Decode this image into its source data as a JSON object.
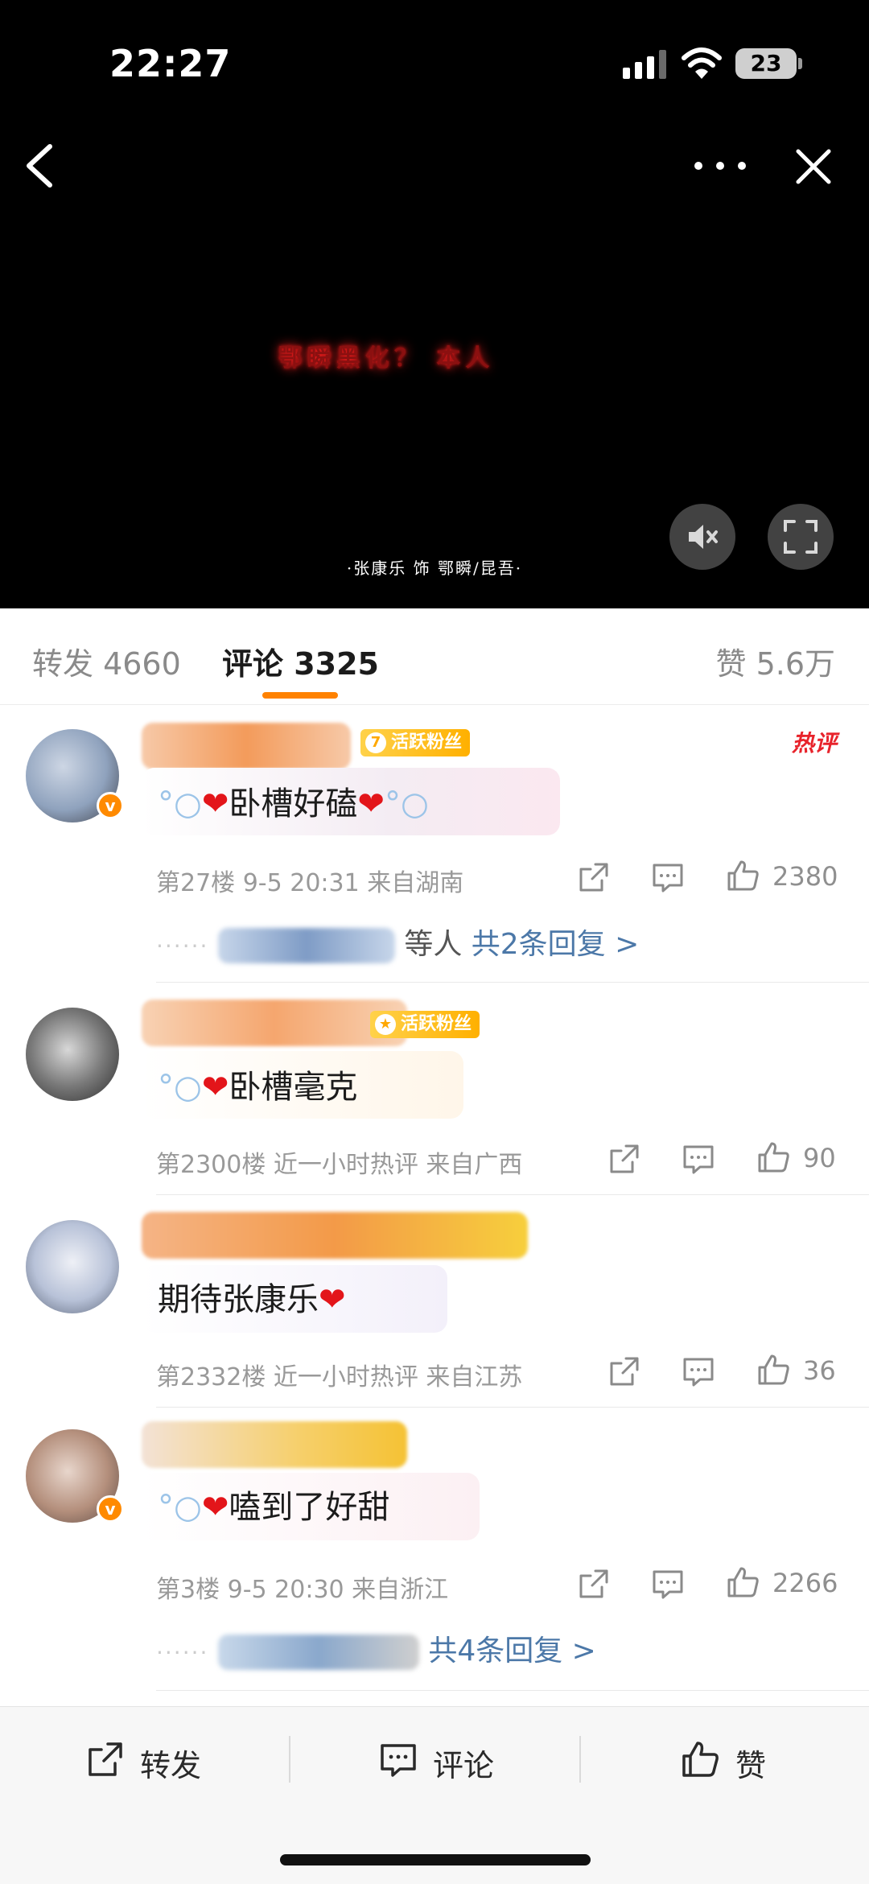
{
  "status_bar": {
    "time": "22:27",
    "battery": "23"
  },
  "video": {
    "caption": "鄂瞬黑化？ 本人",
    "subtitle": "·张康乐 饰 鄂瞬/昆吾·"
  },
  "tabs": {
    "repost": "转发 4660",
    "comment": "评论 3325",
    "like": "赞 5.6万"
  },
  "comments": [
    {
      "fan_badge": "活跃粉丝",
      "fan_level": "7",
      "hot_tag": "热评",
      "text": "卧槽好磕",
      "meta": "第27楼 9-5 20:31 来自湖南",
      "likes": "2380",
      "reply_who": "等人",
      "reply_link": "共2条回复 >"
    },
    {
      "fan_badge": "活跃粉丝",
      "text": "卧槽毫克",
      "meta": "第2300楼 近一小时热评 来自广西",
      "likes": "90"
    },
    {
      "text": "期待张康乐",
      "meta": "第2332楼 近一小时热评 来自江苏",
      "likes": "36"
    },
    {
      "text": "嗑到了好甜",
      "meta": "第3楼 9-5 20:30 来自浙江",
      "likes": "2266",
      "reply_link": "共4条回复 >"
    }
  ],
  "bottom_bar": {
    "repost": "转发",
    "comment": "评论",
    "like": "赞"
  },
  "colors": {
    "accent": "#ff8200",
    "link": "#4c78a8",
    "hot": "#e8232b",
    "heart": "#e3151a"
  }
}
